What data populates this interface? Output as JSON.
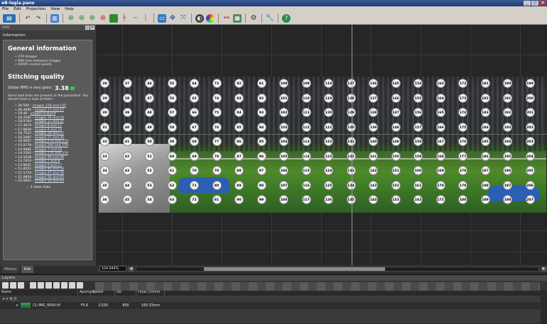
{
  "window": {
    "title": "eB-legia.pano",
    "controls": [
      "_",
      "□",
      "x"
    ]
  },
  "menu": [
    "File",
    "Edit",
    "Projection",
    "View",
    "Help"
  ],
  "left_panel": {
    "title": "Info",
    "subtitle": "Information",
    "general_heading": "General information",
    "general_items": [
      "279 images",
      "996 links between images",
      "64965 control points"
    ],
    "quality_heading": "Stitching quality",
    "rms_label": "Global RMS is very good :",
    "rms_value": "3.38",
    "bad_links_note": "Some bad links are present in the panorama. You should have a look at them :",
    "links": [
      {
        "v": "34.594 :",
        "l": "images 126 and 135"
      },
      {
        "v": "26.4082 :",
        "l": "images 17 and 27"
      },
      {
        "v": "18.46 :",
        "l": "images 8 and 9"
      },
      {
        "v": "18.2581 :",
        "l": "images 16 and 26"
      },
      {
        "v": "18.0764 :",
        "l": "images 17 and 27"
      },
      {
        "v": "17.3679 :",
        "l": "images 8 and 17"
      },
      {
        "v": "17.0839 :",
        "l": "images 8 and 16"
      },
      {
        "v": "16.7522 :",
        "l": "images 26 and 27"
      },
      {
        "v": "16.2087 :",
        "l": "images 27 and 35"
      },
      {
        "v": "16.0007 :",
        "l": "images 270 and 276"
      },
      {
        "v": "15.0778 :",
        "l": "images 264 and 279"
      },
      {
        "v": "14.9985 :",
        "l": "images 7 and 16"
      },
      {
        "v": "14.5592 :",
        "l": "images 270 and 279"
      },
      {
        "v": "14.1638 :",
        "l": "images 49 and 58"
      },
      {
        "v": "13.7454 :",
        "l": "images 7 and 8"
      },
      {
        "v": "13.9641 :",
        "l": "images 9 and 17"
      },
      {
        "v": "11.8552 :",
        "l": "images 46 and 56"
      },
      {
        "v": "11.1733 :",
        "l": "images 47 and 56"
      },
      {
        "v": "11.0859 :",
        "l": "images 56 and 65"
      },
      {
        "v": "10.5852 :",
        "l": "images 56 and 63"
      }
    ],
    "more": "... 1 more links",
    "tabs": [
      "History",
      "Info"
    ]
  },
  "viewport": {
    "zoom": "104,944%",
    "points": [
      [
        "28",
        "37",
        "46",
        "55",
        "64",
        "73",
        "82",
        "91",
        "100",
        "109",
        "118",
        "127",
        "136",
        "145",
        "154",
        "163",
        "172",
        "181",
        "190",
        "199"
      ],
      [
        "29",
        "38",
        "47",
        "56",
        "65",
        "74",
        "83",
        "92",
        "101",
        "110",
        "119",
        "128",
        "137",
        "146",
        "155",
        "164",
        "173",
        "182",
        "191",
        "200"
      ],
      [
        "30",
        "39",
        "48",
        "57",
        "66",
        "75",
        "84",
        "93",
        "102",
        "111",
        "120",
        "129",
        "138",
        "147",
        "156",
        "165",
        "174",
        "183",
        "192",
        "201"
      ],
      [
        "31",
        "40",
        "49",
        "58",
        "67",
        "76",
        "85",
        "94",
        "103",
        "112",
        "121",
        "130",
        "139",
        "148",
        "157",
        "166",
        "175",
        "184",
        "193",
        "202"
      ],
      [
        "32",
        "41",
        "50",
        "59",
        "68",
        "77",
        "86",
        "95",
        "104",
        "113",
        "122",
        "131",
        "140",
        "149",
        "158",
        "167",
        "176",
        "185",
        "194",
        "203"
      ],
      [
        "33",
        "42",
        "51",
        "60",
        "69",
        "78",
        "87",
        "96",
        "105",
        "114",
        "123",
        "132",
        "141",
        "150",
        "159",
        "168",
        "177",
        "186",
        "195",
        "204"
      ],
      [
        "34",
        "43",
        "52",
        "61",
        "70",
        "79",
        "88",
        "97",
        "106",
        "115",
        "124",
        "133",
        "142",
        "151",
        "160",
        "169",
        "178",
        "187",
        "196",
        "205"
      ],
      [
        "35",
        "44",
        "53",
        "62",
        "71",
        "80",
        "89",
        "98",
        "107",
        "116",
        "125",
        "134",
        "143",
        "152",
        "161",
        "170",
        "179",
        "188",
        "197",
        "206"
      ],
      [
        "36",
        "45",
        "54",
        "63",
        "72",
        "81",
        "90",
        "99",
        "108",
        "117",
        "126",
        "135",
        "144",
        "153",
        "162",
        "171",
        "180",
        "189",
        "198",
        "207"
      ]
    ]
  },
  "layers": {
    "title": "Layers",
    "columns": [
      "Name",
      "Aperture",
      "Speed",
      "Iso",
      "Focal (35mm"
    ],
    "group": "N_0",
    "row": {
      "name": "(1) IMG_9054.tif",
      "aperture": "F5.6",
      "speed": "1/100",
      "iso": "800",
      "focal": "160.33mm"
    }
  }
}
